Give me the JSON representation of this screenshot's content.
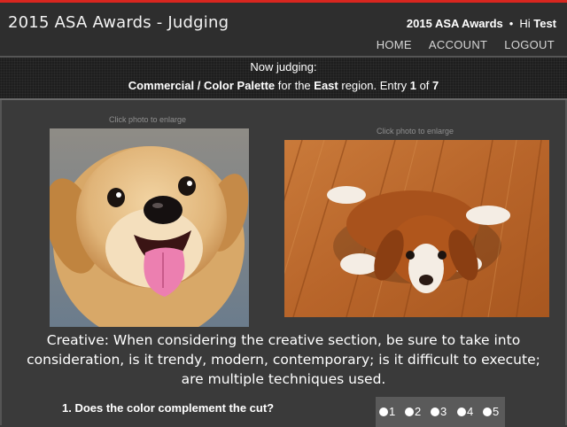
{
  "header": {
    "title": "2015 ASA Awards - Judging",
    "brand": "2015 ASA Awards",
    "separator": "•",
    "greeting": "Hi",
    "username": "Test",
    "nav": [
      "HOME",
      "ACCOUNT",
      "LOGOUT"
    ]
  },
  "judging": {
    "heading": "Now judging:",
    "category": "Commercial / Color Palette",
    "for_the": "for the",
    "region": "East",
    "region_word": "region. Entry",
    "entry_number": "1",
    "of_word": "of",
    "entry_total": "7"
  },
  "photos": [
    {
      "caption": "Click photo to enlarge",
      "subject": "puppy-close-up-photo"
    },
    {
      "caption": "Click photo to enlarge",
      "subject": "puppy-on-floor-photo"
    }
  ],
  "criteria_text": "Creative: When considering the creative section, be sure to take into consideration, is it trendy, modern, contemporary; is it difficult to execute; are multiple techniques used.",
  "question": {
    "text": "1. Does the color complement the cut?",
    "options": [
      "1",
      "2",
      "3",
      "4",
      "5"
    ]
  },
  "colors": {
    "accent_red": "#d8261f",
    "header_bg": "#2e2e2e",
    "page_bg": "#3a3a3a"
  }
}
